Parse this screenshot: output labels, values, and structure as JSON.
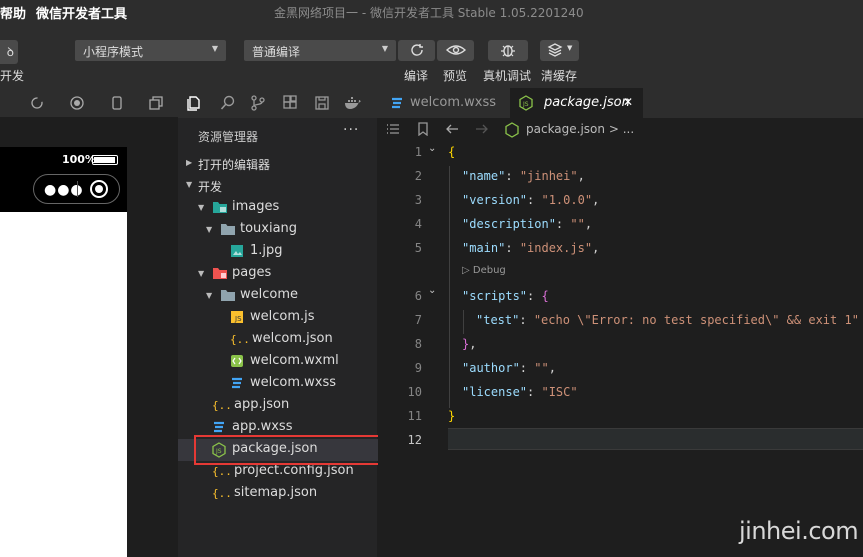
{
  "titlebar": {
    "menu_help": "帮助",
    "menu_app": "微信开发者工具",
    "title": "金黑网络项目一 - 微信开发者工具 Stable 1.05.2201240"
  },
  "toolbar": {
    "left_label": "开发",
    "mode_select": "小程序模式",
    "compile_select": "普通编译",
    "compile_label": "编译",
    "preview_label": "预览",
    "debug_label": "真机调试",
    "cache_label": "清缓存"
  },
  "simulator": {
    "battery": "100%"
  },
  "explorer": {
    "title": "资源管理器",
    "more": "···",
    "open_editors": "打开的编辑器",
    "project": "开发",
    "items": [
      {
        "label": "images",
        "depth": 1,
        "kind": "folder-images",
        "expanded": true
      },
      {
        "label": "touxiang",
        "depth": 2,
        "kind": "folder",
        "expanded": true
      },
      {
        "label": "1.jpg",
        "depth": 3,
        "kind": "image"
      },
      {
        "label": "pages",
        "depth": 1,
        "kind": "folder-pages",
        "expanded": true
      },
      {
        "label": "welcome",
        "depth": 2,
        "kind": "folder",
        "expanded": true
      },
      {
        "label": "welcom.js",
        "depth": 3,
        "kind": "js"
      },
      {
        "label": "welcom.json",
        "depth": 3,
        "kind": "json"
      },
      {
        "label": "welcom.wxml",
        "depth": 3,
        "kind": "wxml"
      },
      {
        "label": "welcom.wxss",
        "depth": 3,
        "kind": "wxss"
      },
      {
        "label": "app.json",
        "depth": 1,
        "kind": "json"
      },
      {
        "label": "app.wxss",
        "depth": 1,
        "kind": "wxss"
      },
      {
        "label": "package.json",
        "depth": 1,
        "kind": "node"
      },
      {
        "label": "project.config.json",
        "depth": 1,
        "kind": "json"
      },
      {
        "label": "sitemap.json",
        "depth": 1,
        "kind": "json"
      }
    ]
  },
  "editor": {
    "tabs": [
      {
        "label": "welcom.wxss",
        "active": false
      },
      {
        "label": "package.json",
        "active": true
      }
    ],
    "close_glyph": "✕",
    "breadcrumb": "package.json > ...",
    "codelens": "▷ Debug",
    "line_numbers": [
      "1",
      "2",
      "3",
      "4",
      "5",
      "6",
      "7",
      "8",
      "9",
      "10",
      "11",
      "12"
    ],
    "code": {
      "l1": "{",
      "l2_key": "\"name\"",
      "l2_val": "\"jinhei\"",
      "l3_key": "\"version\"",
      "l3_val": "\"1.0.0\"",
      "l4_key": "\"description\"",
      "l4_val": "\"\"",
      "l5_key": "\"main\"",
      "l5_val": "\"index.js\"",
      "l6_key": "\"scripts\"",
      "l6_open": "{",
      "l7_key": "\"test\"",
      "l7_val": "\"echo \\\"Error: no test specified\\\" && exit 1\"",
      "l8_close": "}",
      "l9_key": "\"author\"",
      "l9_val": "\"\"",
      "l10_key": "\"license\"",
      "l10_val": "\"ISC\"",
      "l11": "}",
      "colon": ": ",
      "comma": ","
    }
  },
  "watermark": "jinhei.com"
}
